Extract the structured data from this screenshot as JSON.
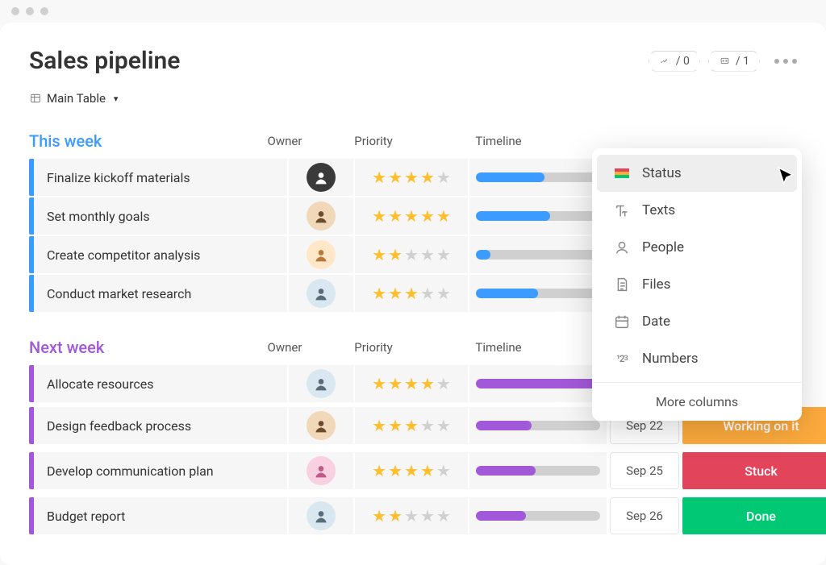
{
  "title": "Sales pipeline",
  "toolbar": {
    "integrations_count": "/ 0",
    "automations_count": "/ 1"
  },
  "view": {
    "name": "Main Table"
  },
  "columns": {
    "owner": "Owner",
    "priority": "Priority",
    "timeline": "Timeline"
  },
  "groups": [
    {
      "name": "This week",
      "color": "blue",
      "rows": [
        {
          "task": "Finalize kickoff materials",
          "avatar": "av-a",
          "stars": 4,
          "progress": 55
        },
        {
          "task": "Set monthly goals",
          "avatar": "av-b",
          "stars": 5,
          "progress": 60
        },
        {
          "task": "Create competitor analysis",
          "avatar": "av-c",
          "stars": 2,
          "progress": 12
        },
        {
          "task": "Conduct market research",
          "avatar": "av-d",
          "stars": 3,
          "progress": 50
        }
      ]
    },
    {
      "name": "Next week",
      "color": "purple",
      "rows": [
        {
          "task": "Allocate resources",
          "avatar": "av-d",
          "stars": 4,
          "progress": 100
        },
        {
          "task": "Design feedback process",
          "avatar": "av-b",
          "stars": 3,
          "progress": 45,
          "date": "Sep 22",
          "status_label": "Working on it",
          "status_class": "st-working"
        },
        {
          "task": "Develop communication plan",
          "avatar": "av-e",
          "stars": 4,
          "progress": 48,
          "date": "Sep 25",
          "status_label": "Stuck",
          "status_class": "st-stuck"
        },
        {
          "task": "Budget report",
          "avatar": "av-d",
          "stars": 2,
          "progress": 40,
          "date": "Sep 26",
          "status_label": "Done",
          "status_class": "st-done"
        }
      ]
    }
  ],
  "column_picker": {
    "items": [
      {
        "id": "status",
        "label": "Status",
        "hover": true
      },
      {
        "id": "texts",
        "label": "Texts"
      },
      {
        "id": "people",
        "label": "People"
      },
      {
        "id": "files",
        "label": "Files"
      },
      {
        "id": "date",
        "label": "Date"
      },
      {
        "id": "numbers",
        "label": "Numbers"
      }
    ],
    "more_label": "More columns"
  }
}
